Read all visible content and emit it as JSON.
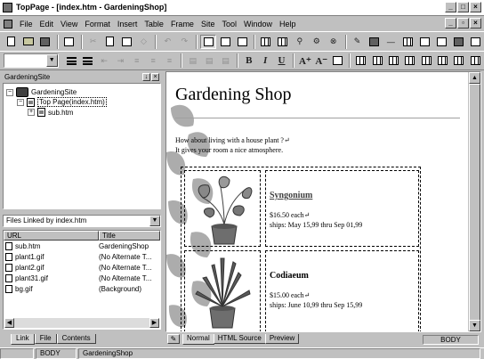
{
  "window": {
    "title": "TopPage - [index.htm - GardeningShop]",
    "controls": [
      "_",
      "□",
      "×"
    ]
  },
  "menubar": {
    "items": [
      "File",
      "Edit",
      "View",
      "Format",
      "Insert",
      "Table",
      "Frame",
      "Site",
      "Tool",
      "Window",
      "Help"
    ],
    "mdi_controls": [
      "_",
      "▫",
      "×"
    ]
  },
  "site_pane": {
    "title": "GardeningSite",
    "tree": {
      "root": "GardeningSite",
      "top_page": "Top Page(index.htm)",
      "child": "sub.htm",
      "collapse_symbol": "−",
      "expand_symbol": "+"
    }
  },
  "links_pane": {
    "selector_value": "Files Linked by index.htm",
    "columns": [
      "URL",
      "Title"
    ],
    "rows": [
      {
        "url": "sub.htm",
        "title": "GardeningShop"
      },
      {
        "url": "plant1.gif",
        "title": "(No Alternate T..."
      },
      {
        "url": "plant2.gif",
        "title": "(No Alternate T..."
      },
      {
        "url": "plant31.gif",
        "title": "(No Alternate T..."
      },
      {
        "url": "bg.gif",
        "title": "(Background)"
      }
    ]
  },
  "left_tabs": [
    "Link",
    "File",
    "Contents"
  ],
  "editor": {
    "page_title": "Gardening Shop",
    "intro_line1": "How about living with a house plant ?↵",
    "intro_line2": "It gives your room a nice atmosphere.",
    "products": [
      {
        "name": "Syngonium",
        "price": "$16.50 each↵",
        "ships": "ships: May 15,99 thru Sep 01,99"
      },
      {
        "name": "Codiaeum",
        "price": "$15.00 each↵",
        "ships": "ships: June 10,99 thru Sep 15,99"
      }
    ]
  },
  "editor_tabs": [
    "Normal",
    "HTML Source",
    "Preview"
  ],
  "editor_tag": "BODY",
  "statusbar": {
    "tag": "BODY",
    "site": "GardeningShop"
  },
  "formatting": {
    "bold": "B",
    "italic": "I",
    "underline": "U",
    "font_up": "A⁺",
    "font_down": "A⁻"
  },
  "colors": {
    "chrome": "#c0c0c0",
    "page_bg": "#ffffff",
    "leaf_green": "#5a5a5a"
  }
}
